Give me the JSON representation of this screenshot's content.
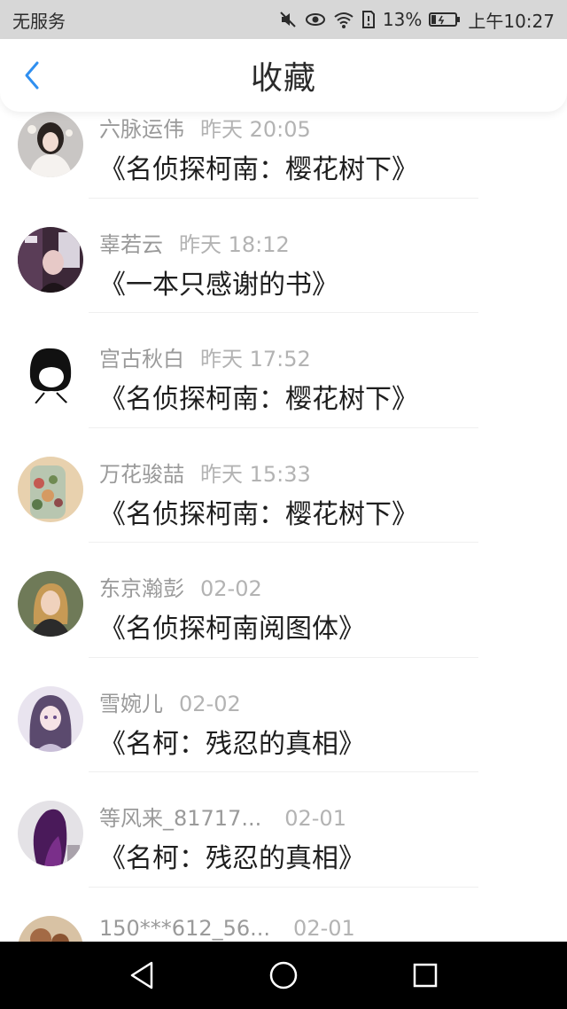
{
  "status_bar": {
    "carrier": "无服务",
    "battery_percent": "13%",
    "time": "上午10:27"
  },
  "header": {
    "title": "收藏",
    "back_icon": "chevron-left-icon",
    "accent_color": "#2f8ff0"
  },
  "favorites": [
    {
      "user": "六脉运伟",
      "time": "昨天 20:05",
      "title": "《名侦探柯南：樱花树下》"
    },
    {
      "user": "辜若云",
      "time": "昨天 18:12",
      "title": "《一本只感谢的书》"
    },
    {
      "user": "宫古秋白",
      "time": "昨天 17:52",
      "title": "《名侦探柯南：樱花树下》"
    },
    {
      "user": "万花骏喆",
      "time": "昨天 15:33",
      "title": "《名侦探柯南：樱花树下》"
    },
    {
      "user": "东京瀚彭",
      "time": "02-02",
      "title": "《名侦探柯南阅图体》"
    },
    {
      "user": "雪婉儿",
      "time": "02-02",
      "title": "《名柯：残忍的真相》"
    },
    {
      "user": "等风来_81717...",
      "time": "02-01",
      "title": "《名柯：残忍的真相》"
    },
    {
      "user": "150***612_56...",
      "time": "02-01",
      "title": ""
    }
  ],
  "nav_bar": {
    "back": "triangle-back-icon",
    "home": "circle-home-icon",
    "recents": "square-recents-icon"
  }
}
